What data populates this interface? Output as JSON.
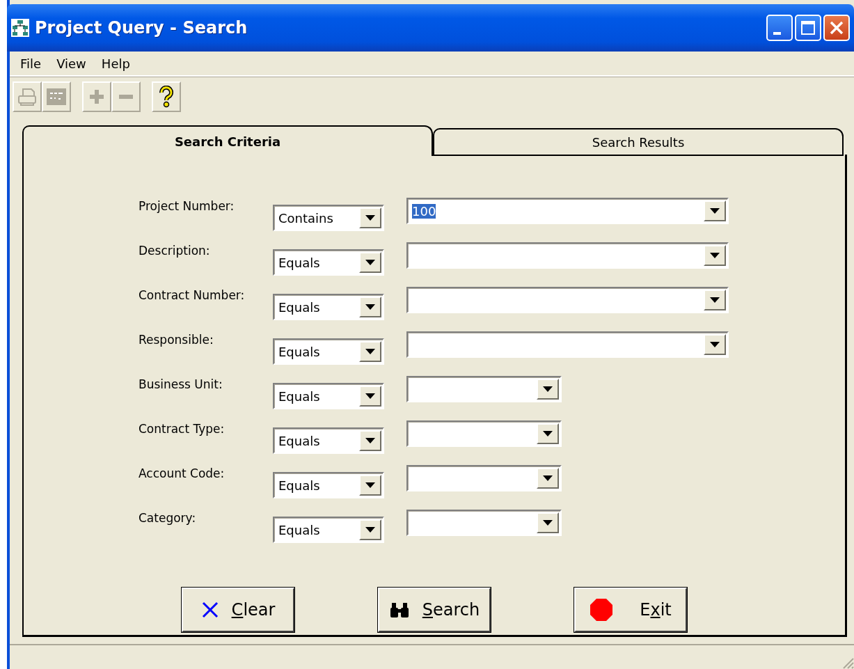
{
  "window": {
    "title": "Project Query - Search"
  },
  "menu": [
    {
      "label": "File"
    },
    {
      "label": "View"
    },
    {
      "label": "Help"
    }
  ],
  "toolbar": [
    {
      "kind": "print",
      "disabled": true
    },
    {
      "kind": "grid",
      "disabled": true
    },
    {
      "kind": "plus",
      "disabled": true
    },
    {
      "kind": "minus",
      "disabled": true
    },
    {
      "kind": "help",
      "disabled": false
    }
  ],
  "tabs": [
    {
      "label": "Search Criteria",
      "selected": true
    },
    {
      "label": "Search Results",
      "selected": false
    }
  ],
  "criteria": [
    {
      "label": "Project Number:",
      "operator": "Contains",
      "value": "100",
      "value_selected": true,
      "kind": "wide"
    },
    {
      "label": "Description:",
      "operator": "Equals",
      "kind": "wide"
    },
    {
      "label": "Contract Number:",
      "operator": "Equals",
      "kind": "wide"
    },
    {
      "label": "Responsible:",
      "operator": "Equals",
      "kind": "wide"
    },
    {
      "label": "Business Unit:",
      "operator": "Equals",
      "kind": "narrow"
    },
    {
      "label": "Contract Type:",
      "operator": "Equals",
      "kind": "narrow"
    },
    {
      "label": "Account Code:",
      "operator": "Equals",
      "kind": "narrow"
    },
    {
      "label": "Category:",
      "operator": "Equals",
      "kind": "narrow"
    }
  ],
  "buttons": [
    {
      "kind": "clear",
      "access_key": "C",
      "label_rest": "lear"
    },
    {
      "kind": "search",
      "access_key": "S",
      "label_rest": "earch"
    },
    {
      "kind": "exit",
      "label_start": "E",
      "access_key": "x",
      "label_rest": "it"
    }
  ]
}
